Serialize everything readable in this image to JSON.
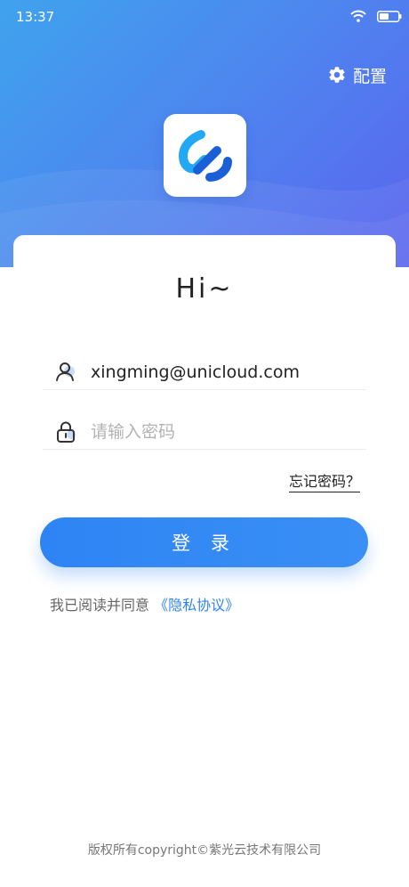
{
  "status_bar": {
    "time": "13:37"
  },
  "header": {
    "config_label": "配置"
  },
  "greeting": "Hi~",
  "login_form": {
    "username_value": "xingming@unicloud.com",
    "password_placeholder": "请输入密码",
    "forgot_label": "忘记密码？",
    "login_label": "登 录",
    "agreement_prefix": "我已阅读并同意",
    "agreement_link": "《隐私协议》"
  },
  "footer": {
    "copyright": "版权所有copyright©紫光云技术有限公司"
  },
  "colors": {
    "primary": "#2e84f4",
    "header_start": "#3fa3ee",
    "header_end": "#5b63ee",
    "logo_light": "#22a8f5",
    "logo_dark": "#1b5fd6"
  }
}
